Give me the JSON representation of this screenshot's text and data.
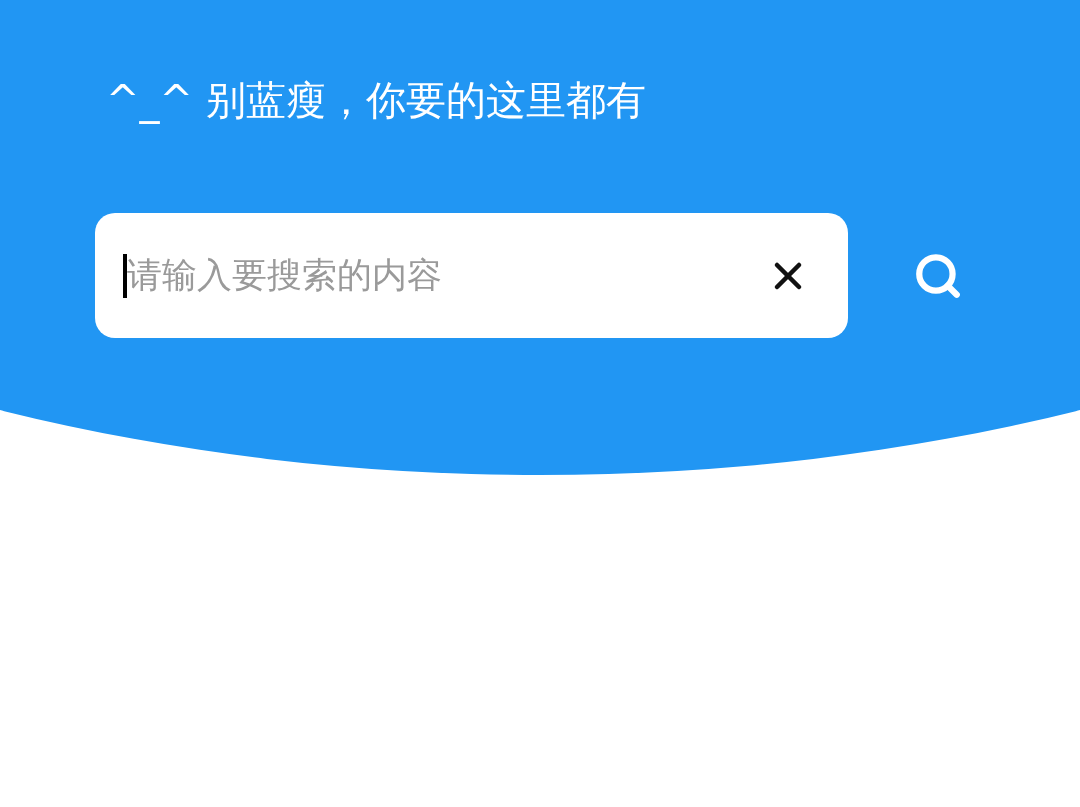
{
  "title": "^_^ 别蓝瘦，你要的这里都有",
  "search": {
    "placeholder": "请输入要搜索的内容"
  }
}
